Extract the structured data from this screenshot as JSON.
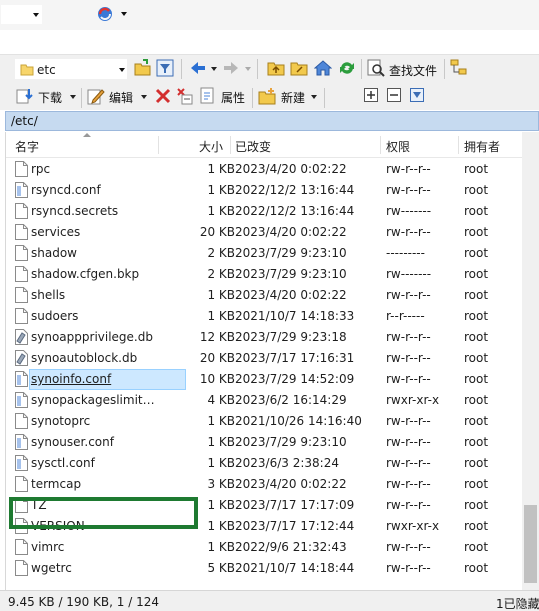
{
  "toolbar_top": {
    "path_value": "etc",
    "find_label": "查找文件"
  },
  "toolbar_actions": {
    "download_label": "下载",
    "edit_label": "编辑",
    "properties_label": "属性",
    "new_label": "新建"
  },
  "pathbar": {
    "path": "/etc/"
  },
  "columns": {
    "name": "名字",
    "size": "大小",
    "modified": "已改变",
    "permissions": "权限",
    "owner": "拥有者"
  },
  "files": [
    {
      "name": "rpc",
      "size": "1 KB",
      "modified": "2023/4/20 0:02:22",
      "perm": "rw-r--r--",
      "owner": "root",
      "icon": "file-icon"
    },
    {
      "name": "rsyncd.conf",
      "size": "1 KB",
      "modified": "2022/12/2 13:16:44",
      "perm": "rw-r--r--",
      "owner": "root",
      "icon": "config-file-icon"
    },
    {
      "name": "rsyncd.secrets",
      "size": "1 KB",
      "modified": "2022/12/2 13:16:44",
      "perm": "rw-------",
      "owner": "root",
      "icon": "file-icon"
    },
    {
      "name": "services",
      "size": "20 KB",
      "modified": "2023/4/20 0:02:22",
      "perm": "rw-r--r--",
      "owner": "root",
      "icon": "file-icon"
    },
    {
      "name": "shadow",
      "size": "2 KB",
      "modified": "2023/7/29 9:23:10",
      "perm": "---------",
      "owner": "root",
      "icon": "file-icon"
    },
    {
      "name": "shadow.cfgen.bkp",
      "size": "2 KB",
      "modified": "2023/7/29 9:23:10",
      "perm": "rw-------",
      "owner": "root",
      "icon": "file-icon"
    },
    {
      "name": "shells",
      "size": "1 KB",
      "modified": "2023/4/20 0:02:22",
      "perm": "rw-r--r--",
      "owner": "root",
      "icon": "file-icon"
    },
    {
      "name": "sudoers",
      "size": "1 KB",
      "modified": "2021/10/7 14:18:33",
      "perm": "r--r-----",
      "owner": "root",
      "icon": "file-icon"
    },
    {
      "name": "synoappprivilege.db",
      "size": "12 KB",
      "modified": "2023/7/29 9:23:18",
      "perm": "rw-r--r--",
      "owner": "root",
      "icon": "database-file-icon"
    },
    {
      "name": "synoautoblock.db",
      "size": "20 KB",
      "modified": "2023/7/17 17:16:31",
      "perm": "rw-r--r--",
      "owner": "root",
      "icon": "database-file-icon"
    },
    {
      "name": "synoinfo.conf",
      "size": "10 KB",
      "modified": "2023/7/29 14:52:09",
      "perm": "rw-r--r--",
      "owner": "root",
      "icon": "config-file-icon",
      "selected": true
    },
    {
      "name": "synopackageslimit…",
      "size": "4 KB",
      "modified": "2023/6/2 16:14:29",
      "perm": "rwxr-xr-x",
      "owner": "root",
      "icon": "config-file-icon"
    },
    {
      "name": "synotoprc",
      "size": "1 KB",
      "modified": "2021/10/26 14:16:40",
      "perm": "rw-r--r--",
      "owner": "root",
      "icon": "file-icon"
    },
    {
      "name": "synouser.conf",
      "size": "1 KB",
      "modified": "2023/7/29 9:23:10",
      "perm": "rw-r--r--",
      "owner": "root",
      "icon": "config-file-icon"
    },
    {
      "name": "sysctl.conf",
      "size": "1 KB",
      "modified": "2023/6/3 2:38:24",
      "perm": "rw-r--r--",
      "owner": "root",
      "icon": "config-file-icon"
    },
    {
      "name": "termcap",
      "size": "3 KB",
      "modified": "2023/4/20 0:02:22",
      "perm": "rw-r--r--",
      "owner": "root",
      "icon": "file-icon"
    },
    {
      "name": "TZ",
      "size": "1 KB",
      "modified": "2023/7/17 17:17:09",
      "perm": "rw-r--r--",
      "owner": "root",
      "icon": "file-icon"
    },
    {
      "name": "VERSION",
      "size": "1 KB",
      "modified": "2023/7/17 17:12:44",
      "perm": "rwxr-xr-x",
      "owner": "root",
      "icon": "file-icon"
    },
    {
      "name": "vimrc",
      "size": "1 KB",
      "modified": "2022/9/6 21:32:43",
      "perm": "rw-r--r--",
      "owner": "root",
      "icon": "file-icon"
    },
    {
      "name": "wgetrc",
      "size": "5 KB",
      "modified": "2021/10/7 14:18:44",
      "perm": "rw-r--r--",
      "owner": "root",
      "icon": "file-icon"
    }
  ],
  "status": {
    "selection": "9.45 KB / 190 KB,   1 / 124",
    "hidden": "1已隐藏"
  },
  "colors": {
    "selection_bg": "#cde8ff",
    "pathbar_bg": "#c6daf0",
    "highlight_box": "#1e7a31"
  }
}
